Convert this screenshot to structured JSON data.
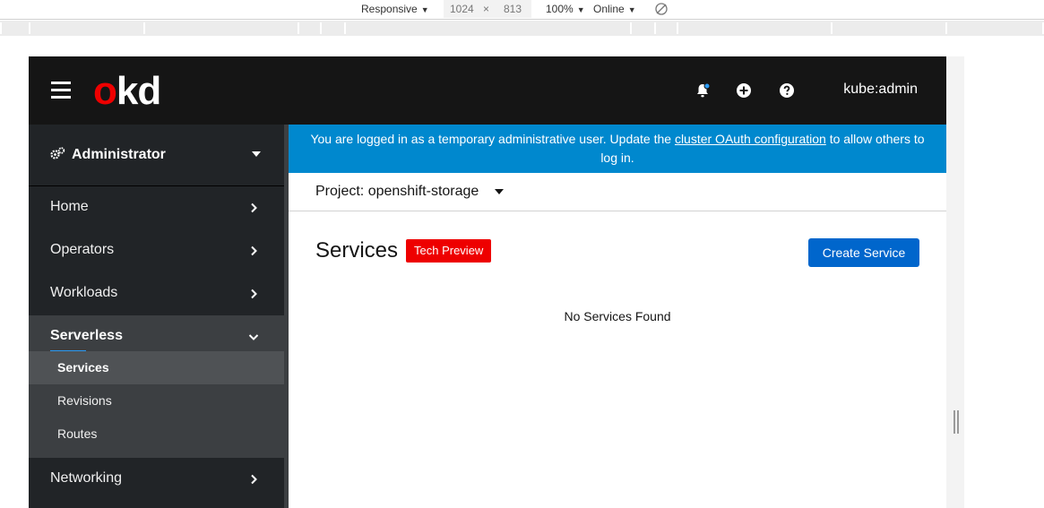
{
  "devtools": {
    "device": "Responsive",
    "width": "1024",
    "times": "×",
    "height": "813",
    "zoom": "100%",
    "throttle": "Online",
    "rotate_icon": "rotate-icon"
  },
  "masthead": {
    "logo_o": "o",
    "logo_rest": "kd",
    "user": "kube:admin",
    "icons": [
      "hamburger-icon",
      "bell-icon",
      "plus-circle-icon",
      "question-circle-icon"
    ]
  },
  "sidebar": {
    "perspective": "Administrator",
    "items": [
      {
        "label": "Home"
      },
      {
        "label": "Operators"
      },
      {
        "label": "Workloads"
      },
      {
        "label": "Serverless"
      },
      {
        "label": "Networking"
      }
    ],
    "subitems": [
      {
        "label": "Services"
      },
      {
        "label": "Revisions"
      },
      {
        "label": "Routes"
      }
    ]
  },
  "banner": {
    "text_before": "You are logged in as a temporary administrative user. Update the ",
    "link": "cluster OAuth configuration",
    "text_after": " to allow others to log in."
  },
  "project": {
    "label": "Project: openshift-storage"
  },
  "page": {
    "title": "Services",
    "badge": "Tech Preview",
    "create_button": "Create Service",
    "empty_message": "No Services Found"
  },
  "colors": {
    "masthead": "#151515",
    "sidebar": "#212427",
    "banner": "#0088ce",
    "primary": "#0066cc",
    "badge": "#ee0000"
  }
}
